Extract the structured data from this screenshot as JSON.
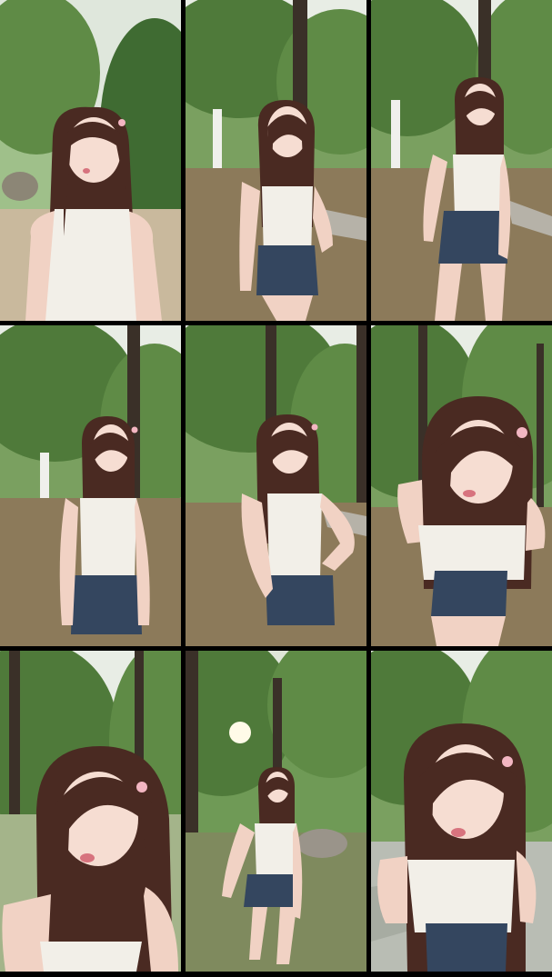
{
  "collage": {
    "layout": "3x3 photo grid",
    "frames": [
      {
        "id": 1,
        "scene": "park-closeup",
        "subject_framing": "close"
      },
      {
        "id": 2,
        "scene": "park-path",
        "subject_framing": "mid"
      },
      {
        "id": 3,
        "scene": "park-path",
        "subject_framing": "mid"
      },
      {
        "id": 4,
        "scene": "park-trees",
        "subject_framing": "mid"
      },
      {
        "id": 5,
        "scene": "park-trees",
        "subject_framing": "mid"
      },
      {
        "id": 6,
        "scene": "park-trees",
        "subject_framing": "close"
      },
      {
        "id": 7,
        "scene": "park-closeup",
        "subject_framing": "close"
      },
      {
        "id": 8,
        "scene": "park-sunlight",
        "subject_framing": "full"
      },
      {
        "id": 9,
        "scene": "park-stones",
        "subject_framing": "close"
      }
    ]
  },
  "colors": {
    "separator": "#000000",
    "foliage": "#4f7a3a",
    "ground": "#8c7a5a",
    "hair": "#4a2a22",
    "top": "#f2efe8",
    "denim": "#34465f",
    "skin": "#f1d2c4"
  }
}
